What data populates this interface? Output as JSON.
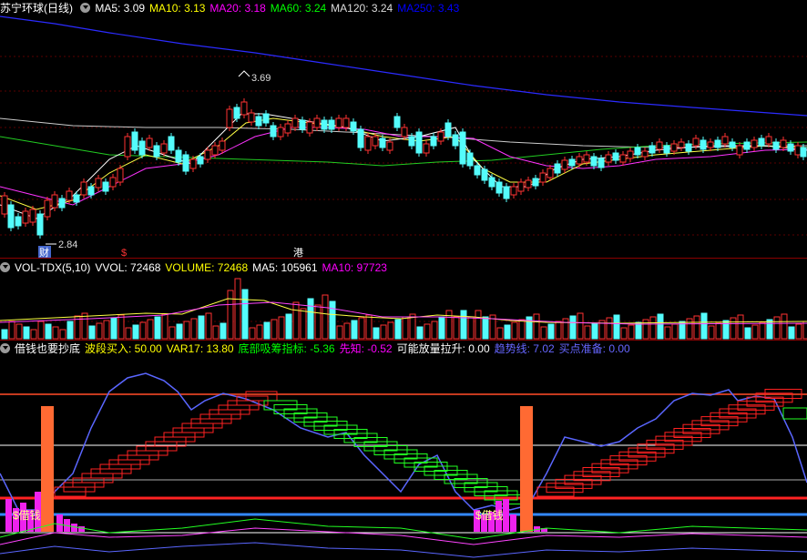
{
  "main_header": {
    "title": "苏宁环球(日线)",
    "items": [
      {
        "label": "MA5: 3.09",
        "color": "#ffffff"
      },
      {
        "label": "MA10: 3.13",
        "color": "#ffff00"
      },
      {
        "label": "MA20: 3.18",
        "color": "#ff00ff"
      },
      {
        "label": "MA60: 3.24",
        "color": "#00ff00"
      },
      {
        "label": "MA120: 3.24",
        "color": "#dddddd"
      },
      {
        "label": "MA250: 3.43",
        "color": "#0000ff"
      }
    ]
  },
  "price_annotations": {
    "high": "3.69",
    "low": "2.84",
    "markers": [
      "财",
      "$",
      "港"
    ]
  },
  "vol_header": {
    "title": "VOL-TDX(5,10)",
    "items": [
      {
        "label": "VVOL: 72468",
        "color": "#ffffff"
      },
      {
        "label": "VOLUME: 72468",
        "color": "#ffff00"
      },
      {
        "label": "MA5: 105961",
        "color": "#ffffff"
      },
      {
        "label": "MA10: 97723",
        "color": "#ff00ff"
      }
    ]
  },
  "ind_header": {
    "title": "借钱也要抄底",
    "items": [
      {
        "label": "波段买入: 50.00",
        "color": "#ffff00"
      },
      {
        "label": "VAR17: 13.80",
        "color": "#ffff00"
      },
      {
        "label": "底部吸筹指标: -5.36",
        "color": "#00ff00"
      },
      {
        "label": "先知: -0.52",
        "color": "#ff00ff"
      },
      {
        "label": "可能放量拉升: 0.00",
        "color": "#ffffff"
      },
      {
        "label": "趋势线: 7.02",
        "color": "#6666ff"
      },
      {
        "label": "买点准备: 0.00",
        "color": "#6666ff"
      }
    ]
  },
  "ind_labels": [
    "$借钱",
    "$借钱"
  ],
  "colors": {
    "up": "#ff3232",
    "down": "#54fcfc",
    "bg": "#000000"
  }
}
